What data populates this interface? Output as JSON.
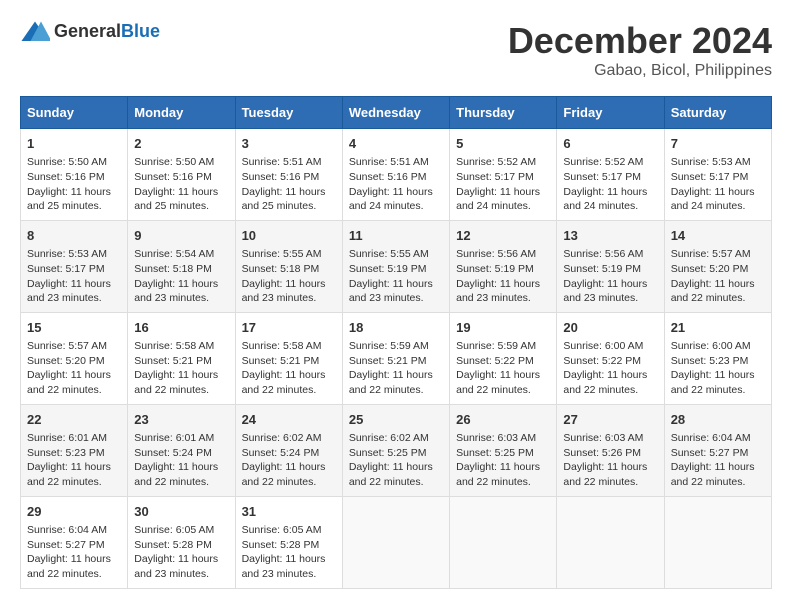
{
  "logo": {
    "text_general": "General",
    "text_blue": "Blue"
  },
  "title": "December 2024",
  "subtitle": "Gabao, Bicol, Philippines",
  "headers": [
    "Sunday",
    "Monday",
    "Tuesday",
    "Wednesday",
    "Thursday",
    "Friday",
    "Saturday"
  ],
  "weeks": [
    [
      {
        "day": "1",
        "sunrise": "5:50 AM",
        "sunset": "5:16 PM",
        "daylight": "11 hours and 25 minutes."
      },
      {
        "day": "2",
        "sunrise": "5:50 AM",
        "sunset": "5:16 PM",
        "daylight": "11 hours and 25 minutes."
      },
      {
        "day": "3",
        "sunrise": "5:51 AM",
        "sunset": "5:16 PM",
        "daylight": "11 hours and 25 minutes."
      },
      {
        "day": "4",
        "sunrise": "5:51 AM",
        "sunset": "5:16 PM",
        "daylight": "11 hours and 24 minutes."
      },
      {
        "day": "5",
        "sunrise": "5:52 AM",
        "sunset": "5:17 PM",
        "daylight": "11 hours and 24 minutes."
      },
      {
        "day": "6",
        "sunrise": "5:52 AM",
        "sunset": "5:17 PM",
        "daylight": "11 hours and 24 minutes."
      },
      {
        "day": "7",
        "sunrise": "5:53 AM",
        "sunset": "5:17 PM",
        "daylight": "11 hours and 24 minutes."
      }
    ],
    [
      {
        "day": "8",
        "sunrise": "5:53 AM",
        "sunset": "5:17 PM",
        "daylight": "11 hours and 23 minutes."
      },
      {
        "day": "9",
        "sunrise": "5:54 AM",
        "sunset": "5:18 PM",
        "daylight": "11 hours and 23 minutes."
      },
      {
        "day": "10",
        "sunrise": "5:55 AM",
        "sunset": "5:18 PM",
        "daylight": "11 hours and 23 minutes."
      },
      {
        "day": "11",
        "sunrise": "5:55 AM",
        "sunset": "5:19 PM",
        "daylight": "11 hours and 23 minutes."
      },
      {
        "day": "12",
        "sunrise": "5:56 AM",
        "sunset": "5:19 PM",
        "daylight": "11 hours and 23 minutes."
      },
      {
        "day": "13",
        "sunrise": "5:56 AM",
        "sunset": "5:19 PM",
        "daylight": "11 hours and 23 minutes."
      },
      {
        "day": "14",
        "sunrise": "5:57 AM",
        "sunset": "5:20 PM",
        "daylight": "11 hours and 22 minutes."
      }
    ],
    [
      {
        "day": "15",
        "sunrise": "5:57 AM",
        "sunset": "5:20 PM",
        "daylight": "11 hours and 22 minutes."
      },
      {
        "day": "16",
        "sunrise": "5:58 AM",
        "sunset": "5:21 PM",
        "daylight": "11 hours and 22 minutes."
      },
      {
        "day": "17",
        "sunrise": "5:58 AM",
        "sunset": "5:21 PM",
        "daylight": "11 hours and 22 minutes."
      },
      {
        "day": "18",
        "sunrise": "5:59 AM",
        "sunset": "5:21 PM",
        "daylight": "11 hours and 22 minutes."
      },
      {
        "day": "19",
        "sunrise": "5:59 AM",
        "sunset": "5:22 PM",
        "daylight": "11 hours and 22 minutes."
      },
      {
        "day": "20",
        "sunrise": "6:00 AM",
        "sunset": "5:22 PM",
        "daylight": "11 hours and 22 minutes."
      },
      {
        "day": "21",
        "sunrise": "6:00 AM",
        "sunset": "5:23 PM",
        "daylight": "11 hours and 22 minutes."
      }
    ],
    [
      {
        "day": "22",
        "sunrise": "6:01 AM",
        "sunset": "5:23 PM",
        "daylight": "11 hours and 22 minutes."
      },
      {
        "day": "23",
        "sunrise": "6:01 AM",
        "sunset": "5:24 PM",
        "daylight": "11 hours and 22 minutes."
      },
      {
        "day": "24",
        "sunrise": "6:02 AM",
        "sunset": "5:24 PM",
        "daylight": "11 hours and 22 minutes."
      },
      {
        "day": "25",
        "sunrise": "6:02 AM",
        "sunset": "5:25 PM",
        "daylight": "11 hours and 22 minutes."
      },
      {
        "day": "26",
        "sunrise": "6:03 AM",
        "sunset": "5:25 PM",
        "daylight": "11 hours and 22 minutes."
      },
      {
        "day": "27",
        "sunrise": "6:03 AM",
        "sunset": "5:26 PM",
        "daylight": "11 hours and 22 minutes."
      },
      {
        "day": "28",
        "sunrise": "6:04 AM",
        "sunset": "5:27 PM",
        "daylight": "11 hours and 22 minutes."
      }
    ],
    [
      {
        "day": "29",
        "sunrise": "6:04 AM",
        "sunset": "5:27 PM",
        "daylight": "11 hours and 22 minutes."
      },
      {
        "day": "30",
        "sunrise": "6:05 AM",
        "sunset": "5:28 PM",
        "daylight": "11 hours and 23 minutes."
      },
      {
        "day": "31",
        "sunrise": "6:05 AM",
        "sunset": "5:28 PM",
        "daylight": "11 hours and 23 minutes."
      },
      null,
      null,
      null,
      null
    ]
  ],
  "labels": {
    "sunrise_prefix": "Sunrise: ",
    "sunset_prefix": "Sunset: ",
    "daylight_prefix": "Daylight: "
  }
}
